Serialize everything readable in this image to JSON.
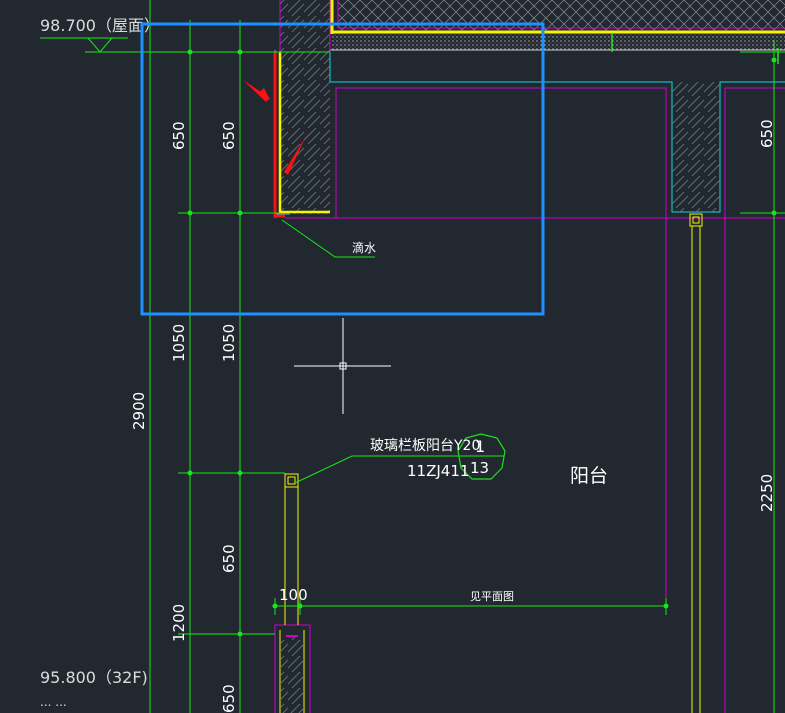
{
  "elevations": {
    "top": "98.700（屋面）",
    "bottom": "95.800（32F)",
    "bottom_partial": "... ..."
  },
  "dimensions": {
    "outer_650_upper": "650",
    "inner_650_upper": "650",
    "outer_1050": "1050",
    "inner_1050": "1050",
    "total_2900": "2900",
    "inner_650_lower": "650",
    "outer_1200": "1200",
    "outer_650_bottom": "650",
    "width_100": "100",
    "right_650": "650",
    "right_2250": "2250"
  },
  "annotations": {
    "drip": "滴水",
    "railing": "玻璃栏板阳台Y20",
    "railing_ref": "11ZJ411",
    "detail_number": "1",
    "detail_sheet": "13",
    "balcony": "阳台",
    "floor_label": "见平面图"
  },
  "colors": {
    "background": "#212830",
    "green": "#19e619",
    "magenta": "#d000d0",
    "cyan": "#12d8d8",
    "yellow": "#f5f500",
    "red": "#ff1010",
    "highlight_box": "#1e90ff",
    "white": "#ffffff",
    "hatch": "#6c7480"
  }
}
